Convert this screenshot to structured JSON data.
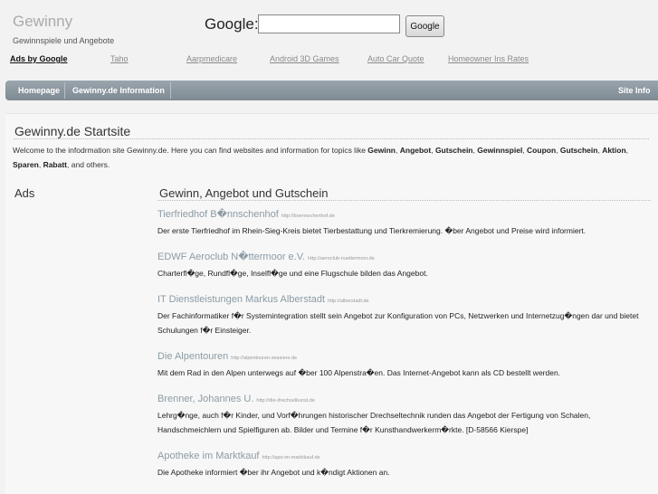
{
  "header": {
    "title": "Gewinny",
    "subtitle": "Gewinnspiele und Angebote",
    "search_label": "Google:",
    "search_value": "",
    "search_button": "Google"
  },
  "adlinks": {
    "label": "Ads by Google",
    "items": [
      "Taho",
      "Aarpmedicare",
      "Android 3D Games",
      "Auto Car Quote",
      "Homeowner Ins Rates"
    ]
  },
  "nav": {
    "items": [
      "Homepage",
      "Gewinny.de Information"
    ],
    "right": "Site Info"
  },
  "page": {
    "title": "Gewinny.de Startsite",
    "intro_parts": [
      {
        "t": "Welcome to the infodrmation site Gewinny.de. Here you can find websites and information for topics like ",
        "b": false
      },
      {
        "t": "Gewinn",
        "b": true
      },
      {
        "t": ", ",
        "b": false
      },
      {
        "t": "Angebot",
        "b": true
      },
      {
        "t": ", ",
        "b": false
      },
      {
        "t": "Gutschein",
        "b": true
      },
      {
        "t": ", ",
        "b": false
      },
      {
        "t": "Gewinnspiel",
        "b": true
      },
      {
        "t": ", ",
        "b": false
      },
      {
        "t": "Coupon",
        "b": true
      },
      {
        "t": ", ",
        "b": false
      },
      {
        "t": "Gutschein",
        "b": true
      },
      {
        "t": ", ",
        "b": false
      },
      {
        "t": "Aktion",
        "b": true
      },
      {
        "t": ", ",
        "b": false
      },
      {
        "t": "Sparen",
        "b": true
      },
      {
        "t": ", ",
        "b": false
      },
      {
        "t": "Rabatt",
        "b": true
      },
      {
        "t": ", and others.",
        "b": false
      }
    ],
    "ads_heading": "Ads",
    "main_heading": "Gewinn, Angebot und Gutschein"
  },
  "entries": [
    {
      "title": "Tierfriedhof B�nnschenhof",
      "url": "http://boennschenhof.de",
      "desc": "Der erste Tierfriedhof im Rhein-Sieg-Kreis bietet Tierbestattung und Tierkremierung. �ber Angebot und Preise wird informiert."
    },
    {
      "title": "EDWF Aeroclub N�ttermoor e.V.",
      "url": "http://aeroclub-nuettermoor.de",
      "desc": "Charterfl�ge, Rundfl�ge, Inselfl�ge und eine Flugschule bilden das Angebot."
    },
    {
      "title": "IT Dienstleistungen Markus Alberstadt",
      "url": "http://alberstadt.de",
      "desc": "Der Fachinformatiker f�r Systemintegration stellt sein Angebot zur Konfiguration von PCs, Netzwerken und Internetzug�ngen dar und bietet Schulungen f�r Einsteiger."
    },
    {
      "title": "Die Alpentouren",
      "url": "http://alpentouren.seasone.de",
      "desc": "Mit dem Rad in den Alpen unterwegs auf �ber 100 Alpenstra�en. Das Internet-Angebot kann als CD bestellt werden."
    },
    {
      "title": "Brenner, Johannes U.",
      "url": "http://die-drechselkunst.de",
      "desc": "Lehrg�nge, auch f�r Kinder, und Vorf�hrungen historischer Drechseltechnik runden das Angebot der Fertigung von Schalen, Handschmeichlern und Spielfiguren ab. Bilder und Termine f�r Kunsthandwerkerm�rkte. [D-58566 Kierspe]"
    },
    {
      "title": "Apotheke im Marktkauf",
      "url": "http://apo-im-marktkauf.de",
      "desc": "Die Apotheke informiert �ber ihr Angebot und k�ndigt Aktionen an."
    }
  ]
}
